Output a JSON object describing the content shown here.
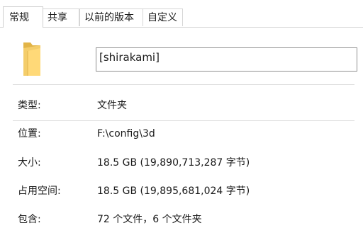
{
  "tabs": [
    {
      "label": "常规",
      "active": true
    },
    {
      "label": "共享",
      "active": false
    },
    {
      "label": "以前的版本",
      "active": false
    },
    {
      "label": "自定义",
      "active": false
    }
  ],
  "folder": {
    "icon": "folder-icon",
    "name": "[shirakami]"
  },
  "properties": {
    "type": {
      "label": "类型:",
      "value": "文件夹"
    },
    "location": {
      "label": "位置:",
      "value": "F:\\config\\3d"
    },
    "size": {
      "label": "大小:",
      "value": "18.5 GB (19,890,713,287 字节)"
    },
    "disk_size": {
      "label": "占用空间:",
      "value": "18.5 GB (19,895,681,024 字节)"
    },
    "contains": {
      "label": "包含:",
      "value": "72 个文件，6 个文件夹"
    }
  },
  "colors": {
    "folder_body": "#f4cd6a",
    "folder_front": "#ffd978",
    "folder_shadow": "#e2b447"
  }
}
